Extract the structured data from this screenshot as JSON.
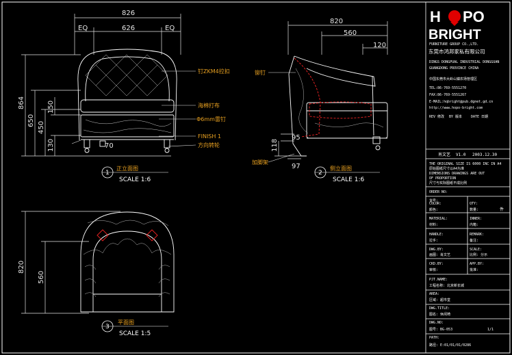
{
  "title_block": {
    "logo_line1_a": "H",
    "logo_line1_b": "PO",
    "logo_line2": "BRIGHT",
    "company_en": "FURNITURE GROUP CO.,LTD.",
    "company_cn": "东莞市鸿邦家私有限公司",
    "address_lines": [
      "DINGS DONGPUAL INDUSTRIAL DONGGUAN",
      "GUANGDONG PROVINCE CHINA",
      "中国东莞市大岭山镇农场管理区",
      "TEL:86-769-5551270",
      "FAX:86-769-5551267",
      "E-MAIL:hqbright@pub.dgnet.gd.cn",
      "http://www.hopo-bright.com"
    ],
    "rev_header": [
      "REV 修改",
      "BY 版本",
      "DATE 日期"
    ],
    "rev_row": [
      "肖文艺",
      "V1.0",
      "2003.12.30"
    ],
    "notice_lines": [
      "THE ORIGINAL SIZE IS 6000 INC IN A4",
      "原始图纸尺寸以A4为准",
      "DIMENSIONS DRAWINGS ARE OUT",
      "OF PROPORTION",
      "尺寸与实际图纸不成比例"
    ],
    "order_no_label": "ORDER NO:",
    "item_no_label": "货号:",
    "fields": [
      {
        "l1": "COLOR:",
        "l2": "颜色:",
        "r1": "QTY:",
        "r2": "数量:",
        "rv": "件"
      },
      {
        "l1": "MATERIAL:",
        "l2": "材料:",
        "r1": "INNER:",
        "r2": "内箱:",
        "rv": ""
      },
      {
        "l1": "HANDLE:",
        "l2": "拉手:",
        "r1": "REMARK:",
        "r2": "备注:",
        "rv": ""
      },
      {
        "l1": "DWG.BY:",
        "l2": "画图: 肖文艺",
        "r1": "SCALE:",
        "r2": "比例: 分示",
        "rv": ""
      },
      {
        "l1": "CKD.BY:",
        "l2": "审核:",
        "r1": "APP.BY:",
        "r2": "批准:",
        "rv": ""
      }
    ],
    "prj_label": "PJT.NAME:",
    "prj_value": "工程名称:    北京新长城",
    "area_label": "AREA:",
    "area_value": "区域:      超市堂",
    "dwg_title_label": "DWG.TITLE:",
    "dwg_title_value": "图名:      休闲椅",
    "dwg_no_label": "DWG.NO:",
    "dwg_no_value": "图号:   BG-053",
    "sheet": "1/1",
    "path_label": "PATH:",
    "path_value": "路径:   E:01/01/01/0286"
  },
  "front_view": {
    "dims": [
      "826",
      "EQ",
      "626",
      "EQ",
      "864",
      "650",
      "450",
      "150",
      "130",
      "70"
    ],
    "notes": [
      "钉ZKM4拉扣",
      "海棉打布",
      "Φ6mm雷钉",
      "FINISH 1",
      "方向转轮"
    ],
    "label_num": "1",
    "label_title": "正立面图",
    "label_scale": "SCALE 1:6"
  },
  "side_view": {
    "dims": [
      "820",
      "560",
      "120",
      "95",
      "118",
      "97"
    ],
    "notes": [
      "铆钉",
      "加脚架"
    ],
    "label_num": "2",
    "label_title": "侧立面图",
    "label_scale": "SCALE 1:6"
  },
  "plan_view": {
    "dims": [
      "820",
      "560"
    ],
    "label_num": "3",
    "label_title": "平面图",
    "label_scale": "SCALE 1:5"
  },
  "colors": {
    "background": "#000000",
    "dim_line": "#e6e6e6",
    "note": "#e8a020",
    "logo_red": "#e00000",
    "dashed_red": "#e02020"
  }
}
